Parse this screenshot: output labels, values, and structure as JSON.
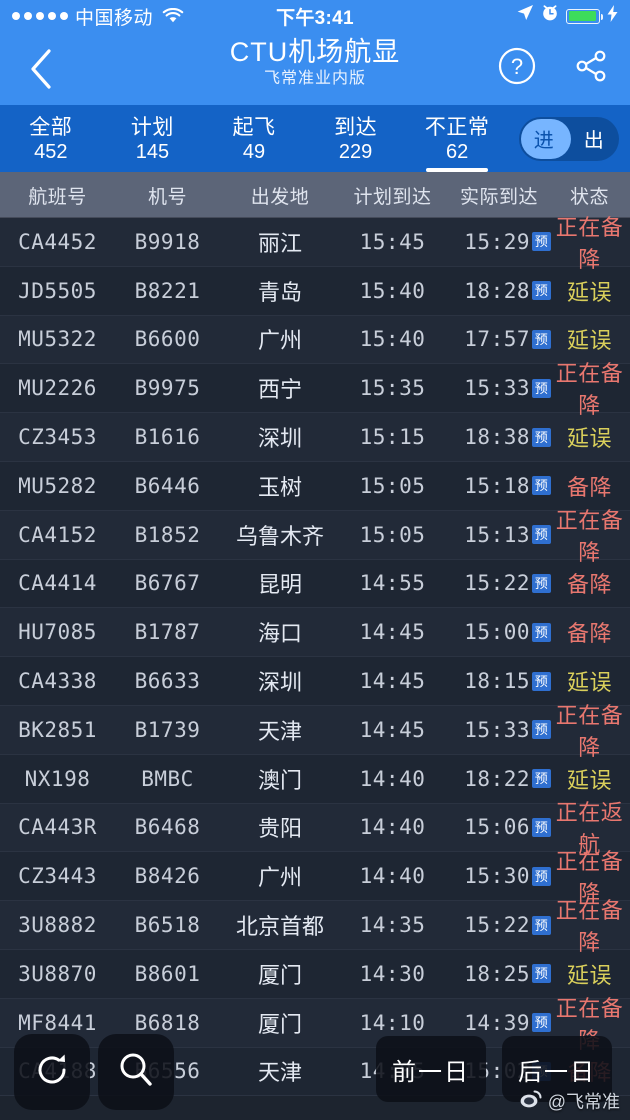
{
  "status_bar": {
    "signal_dots": 5,
    "carrier": "中国移动",
    "wifi_icon": "wifi-icon",
    "time": "下午3:41",
    "location_icon": "location-arrow-icon",
    "alarm_icon": "alarm-clock-icon",
    "battery_icon": "battery-icon",
    "charging_icon": "lightning-bolt-icon",
    "battery_color": "#3ddc5b"
  },
  "navbar": {
    "back_icon": "chevron-left-icon",
    "title": "CTU机场航显",
    "subtitle": "飞常准业内版",
    "help_icon": "question-circle-icon",
    "share_icon": "share-nodes-icon",
    "background": "#3b8ef0"
  },
  "tabs": {
    "background": "#1463c6",
    "items": [
      {
        "label": "全部",
        "count": "452",
        "active": false
      },
      {
        "label": "计划",
        "count": "145",
        "active": false
      },
      {
        "label": "起飞",
        "count": "49",
        "active": false
      },
      {
        "label": "到达",
        "count": "229",
        "active": false
      },
      {
        "label": "不正常",
        "count": "62",
        "active": true
      }
    ],
    "toggle": {
      "on_label": "进",
      "off_label": "出",
      "selected": "进"
    }
  },
  "table": {
    "header_background": "#5c6578",
    "columns": [
      "航班号",
      "机号",
      "出发地",
      "计划到达",
      "实际到达",
      "状态"
    ],
    "estimate_badge": "预",
    "status_colors": {
      "延误": "#d9cf5b",
      "备降": "#e8776f",
      "正在备降": "#e8776f",
      "正在返航": "#e8776f"
    },
    "rows": [
      {
        "flight": "CA4452",
        "tail": "B9918",
        "from": "丽江",
        "sched": "15:45",
        "actual": "15:29",
        "badge": "预",
        "status": "正在备降",
        "status_class": "st-alt"
      },
      {
        "flight": "JD5505",
        "tail": "B8221",
        "from": "青岛",
        "sched": "15:40",
        "actual": "18:28",
        "badge": "预",
        "status": "延误",
        "status_class": "st-delay"
      },
      {
        "flight": "MU5322",
        "tail": "B6600",
        "from": "广州",
        "sched": "15:40",
        "actual": "17:57",
        "badge": "预",
        "status": "延误",
        "status_class": "st-delay"
      },
      {
        "flight": "MU2226",
        "tail": "B9975",
        "from": "西宁",
        "sched": "15:35",
        "actual": "15:33",
        "badge": "预",
        "status": "正在备降",
        "status_class": "st-alt"
      },
      {
        "flight": "CZ3453",
        "tail": "B1616",
        "from": "深圳",
        "sched": "15:15",
        "actual": "18:38",
        "badge": "预",
        "status": "延误",
        "status_class": "st-delay"
      },
      {
        "flight": "MU5282",
        "tail": "B6446",
        "from": "玉树",
        "sched": "15:05",
        "actual": "15:18",
        "badge": "预",
        "status": "备降",
        "status_class": "st-alt"
      },
      {
        "flight": "CA4152",
        "tail": "B1852",
        "from": "乌鲁木齐",
        "sched": "15:05",
        "actual": "15:13",
        "badge": "预",
        "status": "正在备降",
        "status_class": "st-alt"
      },
      {
        "flight": "CA4414",
        "tail": "B6767",
        "from": "昆明",
        "sched": "14:55",
        "actual": "15:22",
        "badge": "预",
        "status": "备降",
        "status_class": "st-alt"
      },
      {
        "flight": "HU7085",
        "tail": "B1787",
        "from": "海口",
        "sched": "14:45",
        "actual": "15:00",
        "badge": "预",
        "status": "备降",
        "status_class": "st-alt"
      },
      {
        "flight": "CA4338",
        "tail": "B6633",
        "from": "深圳",
        "sched": "14:45",
        "actual": "18:15",
        "badge": "预",
        "status": "延误",
        "status_class": "st-delay"
      },
      {
        "flight": "BK2851",
        "tail": "B1739",
        "from": "天津",
        "sched": "14:45",
        "actual": "15:33",
        "badge": "预",
        "status": "正在备降",
        "status_class": "st-alt"
      },
      {
        "flight": "NX198",
        "tail": "BMBC",
        "from": "澳门",
        "sched": "14:40",
        "actual": "18:22",
        "badge": "预",
        "status": "延误",
        "status_class": "st-delay"
      },
      {
        "flight": "CA443R",
        "tail": "B6468",
        "from": "贵阳",
        "sched": "14:40",
        "actual": "15:06",
        "badge": "预",
        "status": "正在返航",
        "status_class": "st-return"
      },
      {
        "flight": "CZ3443",
        "tail": "B8426",
        "from": "广州",
        "sched": "14:40",
        "actual": "15:30",
        "badge": "预",
        "status": "正在备降",
        "status_class": "st-alt"
      },
      {
        "flight": "3U8882",
        "tail": "B6518",
        "from": "北京首都",
        "sched": "14:35",
        "actual": "15:22",
        "badge": "预",
        "status": "正在备降",
        "status_class": "st-alt"
      },
      {
        "flight": "3U8870",
        "tail": "B8601",
        "from": "厦门",
        "sched": "14:30",
        "actual": "18:25",
        "badge": "预",
        "status": "延误",
        "status_class": "st-delay"
      },
      {
        "flight": "MF8441",
        "tail": "B6818",
        "from": "厦门",
        "sched": "14:10",
        "actual": "14:39",
        "badge": "预",
        "status": "正在备降",
        "status_class": "st-alt"
      },
      {
        "flight": "CA4188",
        "tail": "B6556",
        "from": "天津",
        "sched": "14:05",
        "actual": "15:02",
        "badge": "预",
        "status": "备降",
        "status_class": "st-alt"
      }
    ]
  },
  "floating": {
    "refresh_icon": "refresh-icon",
    "search_icon": "search-icon",
    "prev_day": "前一日",
    "next_day": "后一日"
  },
  "watermark": {
    "icon": "weibo-icon",
    "text": "@飞常准"
  }
}
